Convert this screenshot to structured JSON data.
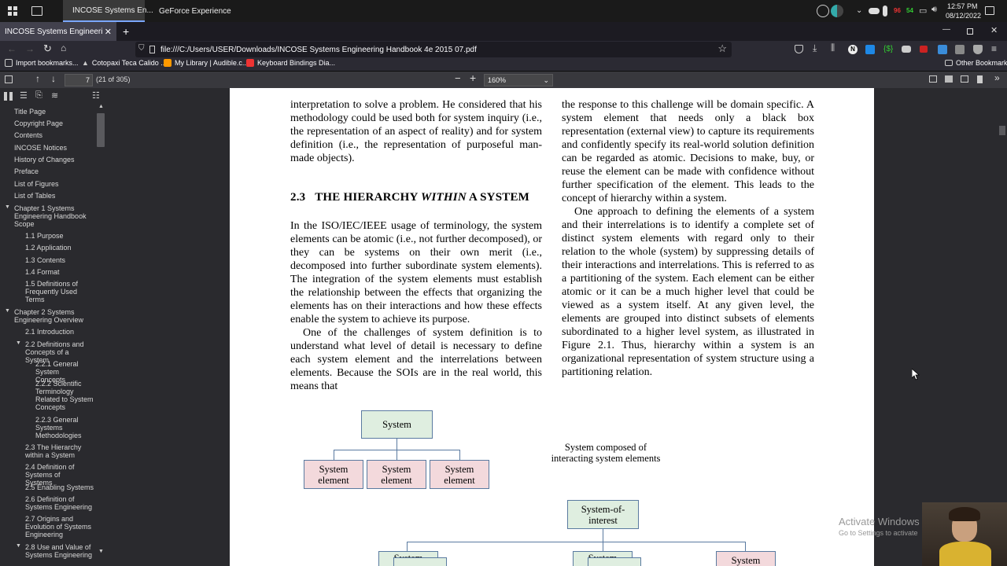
{
  "taskbar": {
    "apps": [
      "INCOSE Systems En...",
      "GeForce Experience"
    ],
    "time": "12:57 PM",
    "date": "08/12/2022"
  },
  "browser": {
    "tab_title": "INCOSE Systems Engineering Handb",
    "url": "file:///C:/Users/USER/Downloads/INCOSE Systems Engineering Handbook 4e 2015 07.pdf",
    "bookmarks": [
      "Import bookmarks...",
      "Cotopaxi Teca Calido ...",
      "My Library | Audible.c...",
      "Keyboard Bindings Dia..."
    ],
    "other_bookmarks": "Other Bookmarks"
  },
  "pdf_toolbar": {
    "page_number": "7",
    "page_count": "(21 of 305)",
    "zoom": "160%"
  },
  "outline": [
    {
      "label": "Title Page"
    },
    {
      "label": "Copyright Page"
    },
    {
      "label": "Contents"
    },
    {
      "label": "INCOSE Notices"
    },
    {
      "label": "History of Changes"
    },
    {
      "label": "Preface"
    },
    {
      "label": "List of Figures"
    },
    {
      "label": "List of Tables"
    },
    {
      "label": "Chapter 1 Systems Engineering Handbook Scope"
    },
    {
      "label": "1.1 Purpose"
    },
    {
      "label": "1.2 Application"
    },
    {
      "label": "1.3 Contents"
    },
    {
      "label": "1.4 Format"
    },
    {
      "label": "1.5 Definitions of Frequently Used Terms"
    },
    {
      "label": "Chapter 2 Systems Engineering Overview"
    },
    {
      "label": "2.1 Introduction"
    },
    {
      "label": "2.2 Definitions and Concepts of a System"
    },
    {
      "label": "2.2.1 General System Concepts"
    },
    {
      "label": "2.2.2 Scientific Terminology Related to System Concepts"
    },
    {
      "label": "2.2.3 General Systems Methodologies"
    },
    {
      "label": "2.3 The Hierarchy within a System"
    },
    {
      "label": "2.4 Definition of Systems of Systems"
    },
    {
      "label": "2.5 Enabling Systems"
    },
    {
      "label": "2.6 Definition of Systems Engineering"
    },
    {
      "label": "2.7 Origins and Evolution of Systems Engineering"
    },
    {
      "label": "2.8 Use and Value of Systems Engineering"
    }
  ],
  "document": {
    "left_para1": "interpretation to solve a problem. He considered that his methodology could be used both for system inquiry (i.e., the representation of an aspect of reality) and for system definition (i.e., the representation of purposeful man-made objects).",
    "heading_num": "2.3",
    "heading_a": "THE HIERARCHY ",
    "heading_b": "WITHIN",
    "heading_c": " A SYSTEM",
    "left_para2": "In the ISO/IEC/IEEE usage of terminology, the system elements can be atomic (i.e., not further decomposed), or they can be systems on their own merit (i.e., decomposed into further subordinate system elements). The integration of the system elements must establish the relationship between the effects that organizing the elements has on their interactions and how these effects enable the system to achieve its purpose.",
    "left_para3": "One of the challenges of system definition is to understand what level of detail is necessary to define each system element and the interrelations between elements. Because the SOIs are in the real world, this means that",
    "right_para1": "the response to this challenge will be domain specific. A system element that needs only a black box representation (external view) to capture its requirements and confidently specify its real-world solution definition can be regarded as atomic. Decisions to make, buy, or reuse the element can be made with confidence without further specification of the element. This leads to the concept of hierarchy within a system.",
    "right_para2": "One approach to defining the elements of a system and their interrelations is to identify a complete set of distinct system elements with regard only to their relation to the whole (system) by suppressing details of their interactions and interrelations. This is referred to as a partitioning of the system. Each element can be either atomic or it can be a much higher level that could be viewed as a system itself. At any given level, the elements are grouped into distinct subsets of elements subordinated to a higher level system, as illustrated in Figure 2.1. Thus, hierarchy within a system is an organizational representation of system structure using a partitioning relation."
  },
  "figure": {
    "top_box": "System",
    "element_label": "System element",
    "caption": "System composed of interacting system elements",
    "soi_box": "System-of-interest",
    "lower_box": "System"
  },
  "watermark": {
    "line1": "Activate Windows",
    "line2": "Go to Settings to activate"
  }
}
